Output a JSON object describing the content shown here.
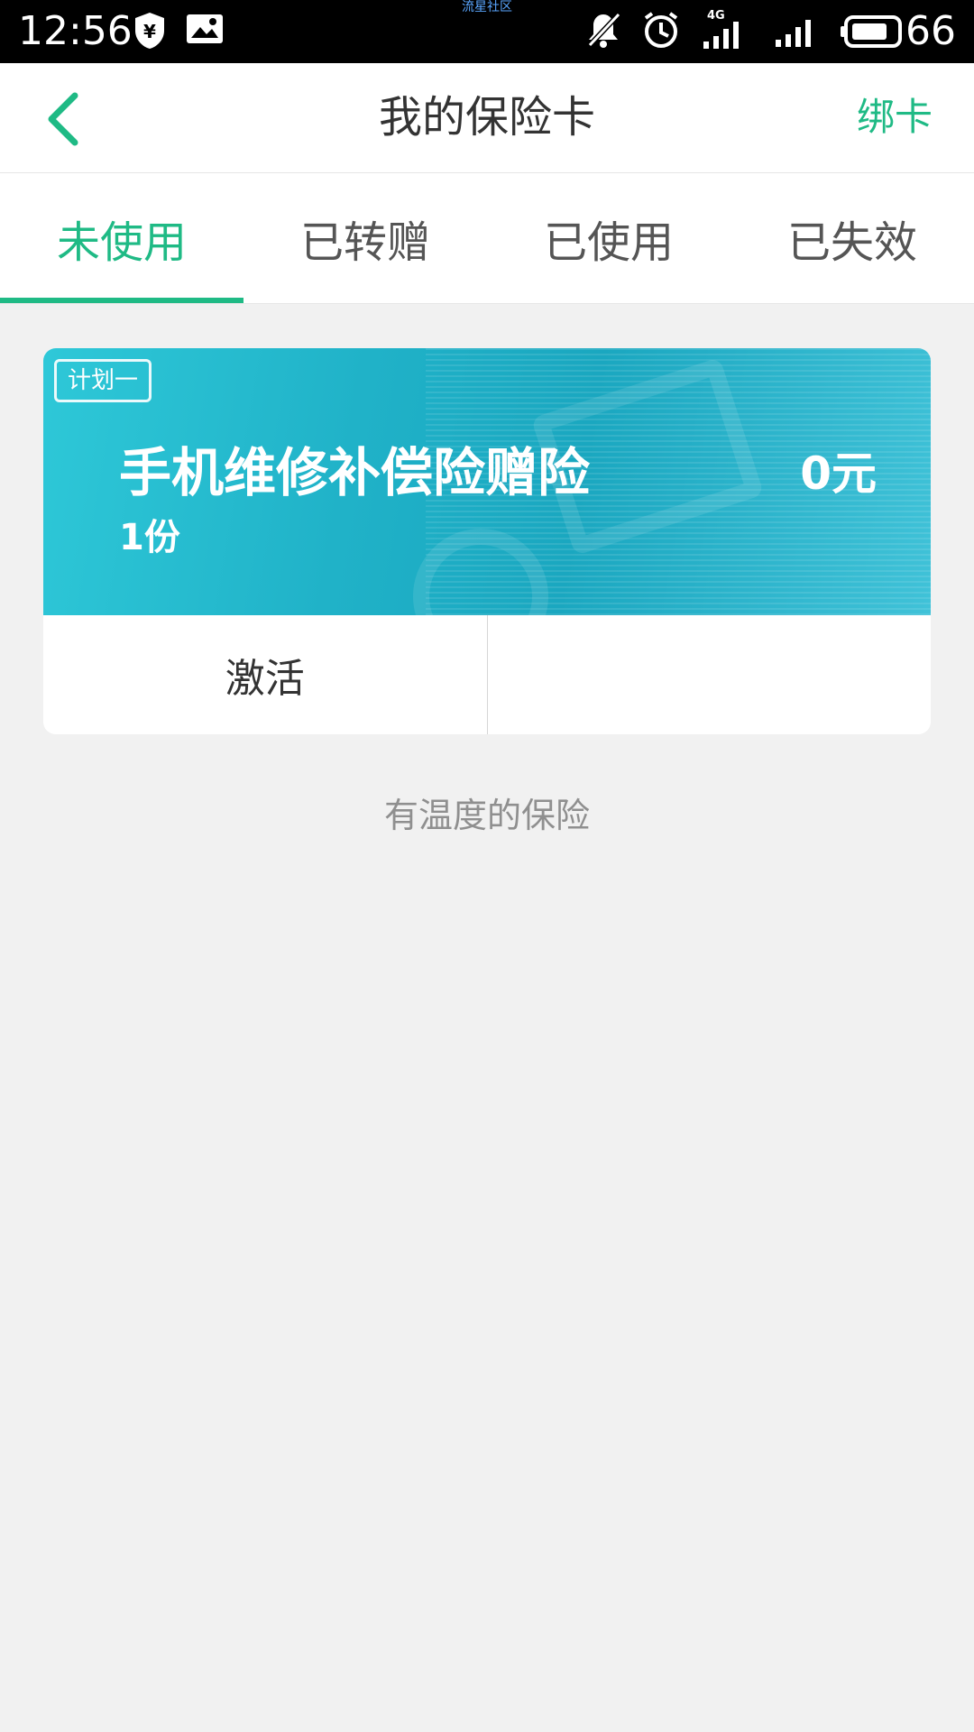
{
  "status_bar": {
    "time": "12:56",
    "watermark": "流星社区",
    "network": "4G",
    "battery": "66",
    "icons": [
      "shield-yuan-icon",
      "image-icon",
      "mute-icon",
      "alarm-icon",
      "signal-4g-icon",
      "signal-icon",
      "battery-icon"
    ]
  },
  "header": {
    "title": "我的保险卡",
    "action": "绑卡",
    "back_icon": "chevron-left-icon",
    "accent_color": "#1fba85"
  },
  "tabs": [
    {
      "label": "未使用",
      "active": true
    },
    {
      "label": "已转赠",
      "active": false
    },
    {
      "label": "已使用",
      "active": false
    },
    {
      "label": "已失效",
      "active": false
    }
  ],
  "card": {
    "plan": "计划一",
    "name": "手机维修补偿险赠险",
    "price": "0元",
    "quantity": "1份",
    "actions": [
      "激活",
      ""
    ]
  },
  "footer": {
    "note": "有温度的保险"
  }
}
